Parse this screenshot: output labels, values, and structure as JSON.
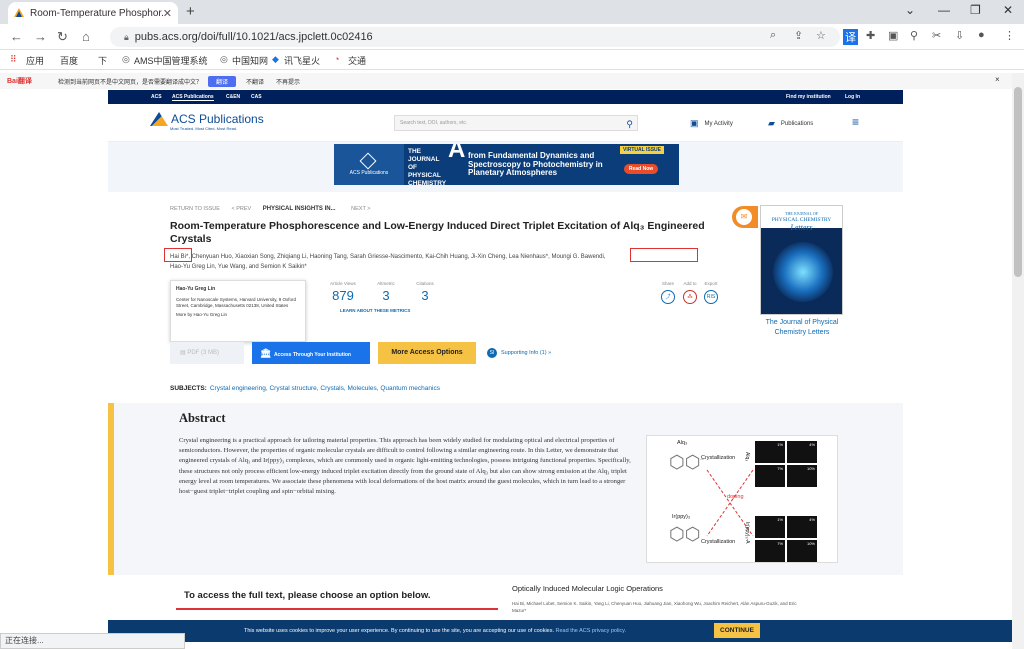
{
  "browser": {
    "tab_title": "Room-Temperature Phosphor...",
    "url": "pubs.acs.org/doi/full/10.1021/acs.jpclett.0c02416",
    "bookmarks": [
      "应用",
      "百度",
      "下",
      "AMS中国管理系统",
      "中国知网",
      "讯飞星火",
      "交通"
    ],
    "status_text": "正在连接..."
  },
  "translate_bar": {
    "message": "检测到当前网页不是中文网页，是否需要翻译成中文？",
    "translate_label": "翻译",
    "no_translate_label": "不翻译",
    "no_prompt_label": "不再提示"
  },
  "acs_top": {
    "links": [
      "ACS",
      "ACS Publications",
      "C&EN",
      "CAS"
    ],
    "find_institution": "Find my institution",
    "login": "Log In"
  },
  "header": {
    "logo_title": "ACS Publications",
    "logo_tagline": "Most Trusted. Most Cited. Most Read.",
    "search_placeholder": "Search text, DOI, authors, etc.",
    "my_activity": "My Activity",
    "publications": "Publications"
  },
  "banner": {
    "left_label": "ACS Publications",
    "journal": "THE JOURNAL OF PHYSICAL CHEMISTRY",
    "journal_letter": "A",
    "message": "from Fundamental Dynamics and Spectroscopy to Photochemistry in Planetary Atmospheres",
    "badge": "VIRTUAL ISSUE",
    "cta": "Read Now"
  },
  "article": {
    "return": "RETURN TO ISSUE",
    "prev": "< PREV",
    "section": "PHYSICAL INSIGHTS IN...",
    "next": "NEXT >",
    "title": "Room-Temperature Phosphorescence and Low-Energy Induced Direct Triplet Excitation of Alq₃ Engineered Crystals",
    "authors_line1": "Hai Bi*, Chenyuan Huo, Xiaoxian Song, Zhiqiang Li, Haoning Tang, Sarah Griesse-Nascimento, Kai-Chih Huang, Ji-Xin Cheng, Lea Nienhaus*, Moungi G. Bawendi,",
    "authors_line2": "Hao-Yu Greg Lin, Yue Wang, and Semion K Saikin*"
  },
  "popup": {
    "name": "Hao-Yu Greg Lin",
    "affil": "Center for Nanoscale Systems, Harvard University, 9 Oxford Street, Cambridge, Massachusetts 02138, United States",
    "more": "More by Hao-Yu Greg Lin"
  },
  "metrics": {
    "views_label": "Article Views",
    "views": "879",
    "altmetric_label": "Altmetric",
    "altmetric": "3",
    "citations_label": "Citations",
    "citations": "3",
    "learn": "LEARN ABOUT THESE METRICS"
  },
  "share": {
    "share_label": "Share",
    "add_label": "Add to",
    "export_label": "Export",
    "export_icon": "RIS"
  },
  "actions": {
    "pdf": "PDF (3 MB)",
    "access": "Access Through Your Institution",
    "more": "More Access Options",
    "supp": "Supporting Info (1) »"
  },
  "subjects": {
    "label": "SUBJECTS:",
    "items": "Crystal engineering, Crystal structure, Crystals, Molecules, Quantum mechanics"
  },
  "journal_cover": {
    "title_top": "THE JOURNAL OF",
    "title_main": "PHYSICAL CHEMISTRY",
    "title_sub": "Letters",
    "link": "The Journal of Physical Chemistry Letters"
  },
  "abstract": {
    "heading": "Abstract",
    "text": "Crystal engineering is a practical approach for tailoring material properties. This approach has been widely studied for modulating optical and electrical properties of semiconductors. However, the properties of organic molecular crystals are difficult to control following a similar engineering route. In this Letter, we demonstrate that engineered crystals of Alq₃ and Ir(ppy)₃ complexes, which are commonly used in organic light-emitting technologies, possess intriguing functional properties. Specifically, these structures not only process efficient low-energy induced triplet excitation directly from the ground state of Alq₃ but also can show strong emission at the Alq₃ triplet energy level at room temperatures. We associate these phenomena with local deformations of the host matrix around the guest molecules, which in turn lead to a stronger host−guest triplet−triplet coupling and spin−orbital mixing."
  },
  "toc": {
    "alq3": "Alq₃",
    "irppy3": "Ir(ppy)₃",
    "crystallization": "Crystallization",
    "doping": "doping",
    "side1": "Alq₃",
    "side2": "Ir(ppy)₃-A",
    "p1": "1%",
    "p4": "4%",
    "p7": "7%",
    "p10": "10%"
  },
  "access": {
    "heading": "To access the full text, please choose an option below."
  },
  "related": {
    "title": "Optically Induced Molecular Logic Operations",
    "authors": "Hai Bi, Michael Lobet, Semion K. Saikin, Yang Li, Chenyuan Huo, Jiahuang Jian, Xiaohong Wu, Joachim Reichert, Alán Aspuru-Guzik, and Eric Mazur*"
  },
  "cookie": {
    "text": "This website uses cookies to improve your user experience. By continuing to use the site, you are accepting our use of cookies.",
    "link": "Read the ACS privacy policy.",
    "button": "CONTINUE"
  }
}
